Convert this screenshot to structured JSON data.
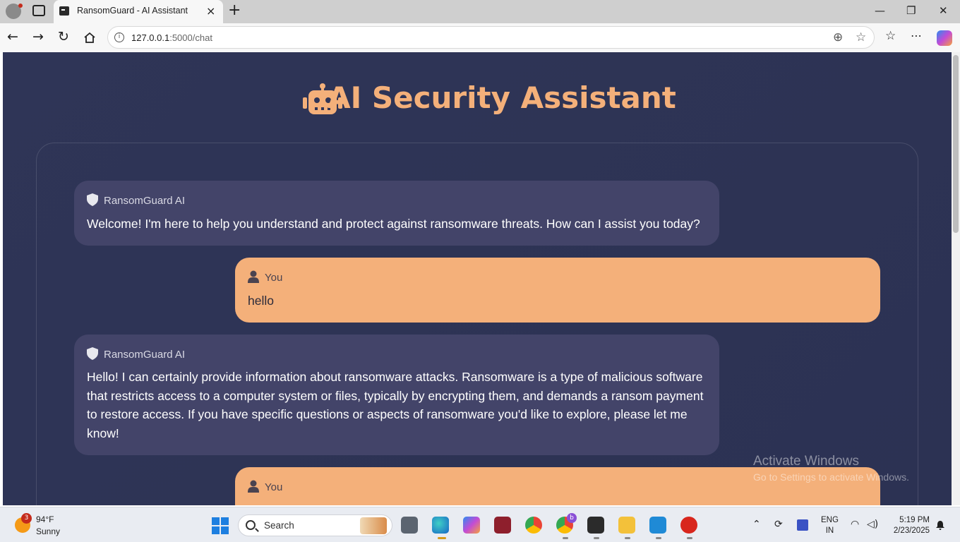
{
  "browser": {
    "tab_title": "RansomGuard - AI Assistant",
    "tab_close": "×",
    "new_tab": "+",
    "url_host": "127.0.0.1",
    "url_rest": ":5000/chat",
    "window_controls": [
      "—",
      "❐",
      "✕"
    ],
    "nav_icons": [
      "back-icon",
      "forward-icon",
      "refresh-icon",
      "home-icon"
    ]
  },
  "page": {
    "title": "AI Security Assistant",
    "accent": "#f4b07a",
    "background": "#2f3557"
  },
  "messages": [
    {
      "role": "bot",
      "sender": "RansomGuard AI",
      "lines": [
        "Welcome! I'm here to help you understand and protect against ransomware threats. How can I assist you today?"
      ]
    },
    {
      "role": "user",
      "sender": "You",
      "lines": [
        "hello"
      ]
    },
    {
      "role": "bot",
      "sender": "RansomGuard AI",
      "lines": [
        "Hello! I can certainly provide information about ransomware attacks. Ransomware is a type of malicious software",
        "that restricts access to a computer system or files, typically by encrypting them, and demands a ransom payment",
        "to restore access. If you have specific questions or aspects of ransomware you'd like to explore, please let me",
        "know!"
      ]
    },
    {
      "role": "user",
      "sender": "You",
      "lines": []
    }
  ],
  "watermark": {
    "title": "Activate Windows",
    "subtitle": "Go to Settings to activate Windows."
  },
  "taskbar": {
    "weather_badge": "3",
    "temperature": "94°F",
    "condition": "Sunny",
    "search_placeholder": "Search",
    "language_top": "ENG",
    "language_bottom": "IN",
    "time": "5:19 PM",
    "date": "2/23/2025",
    "chrome_badge": "b"
  }
}
